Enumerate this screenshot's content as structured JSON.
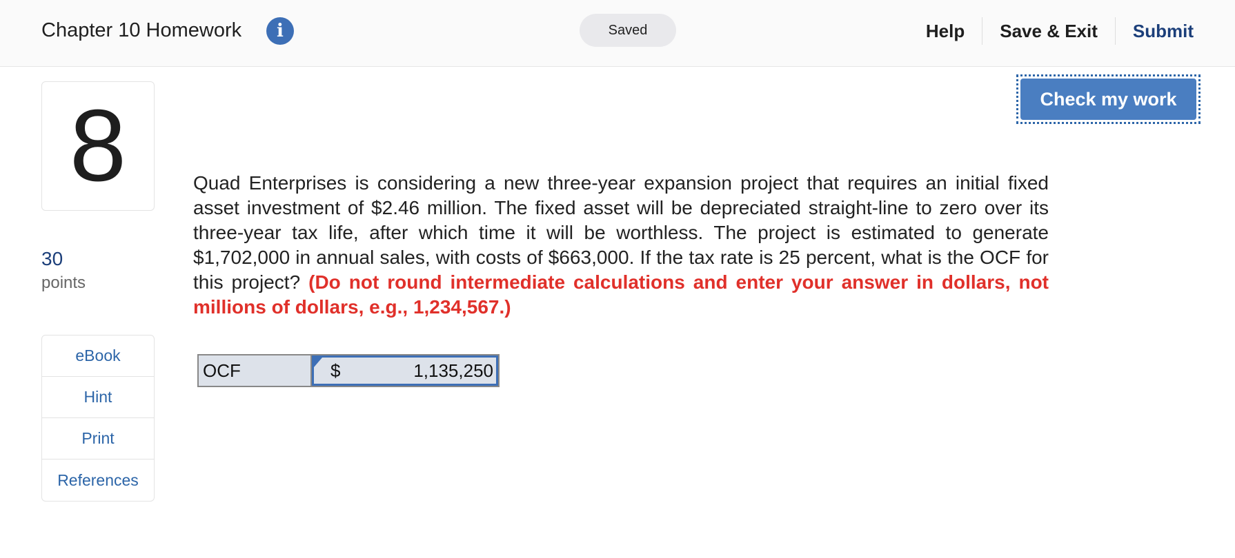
{
  "header": {
    "title": "Chapter 10 Homework",
    "info_icon": "info-icon",
    "status": "Saved",
    "nav": {
      "help": "Help",
      "save_exit": "Save & Exit",
      "submit": "Submit"
    }
  },
  "question": {
    "number": "8",
    "points_value": "30",
    "points_label": "points",
    "text": "Quad Enterprises is considering a new three-year expansion project that requires an initial fixed asset investment of $2.46 million. The fixed asset will be depreciated straight-line to zero over its three-year tax life, after which time it will be worthless. The project is estimated to generate $1,702,000 in annual sales, with costs of $663,000. If the tax rate is 25 percent, what is the OCF for this project? ",
    "instruction": "(Do not round intermediate calculations and enter your answer in dollars, not millions of dollars, e.g., 1,234,567.)"
  },
  "resources": {
    "items": [
      {
        "label": "eBook"
      },
      {
        "label": "Hint"
      },
      {
        "label": "Print"
      },
      {
        "label": "References"
      }
    ]
  },
  "check_button": {
    "label": "Check my work"
  },
  "answer": {
    "label": "OCF",
    "currency": "$",
    "value": "1,135,250"
  },
  "colors": {
    "accent": "#4a7ec1",
    "link": "#2c65a8",
    "submit": "#1c3f7a",
    "instruction": "#e0302a",
    "cell_background": "#dde2ea"
  }
}
